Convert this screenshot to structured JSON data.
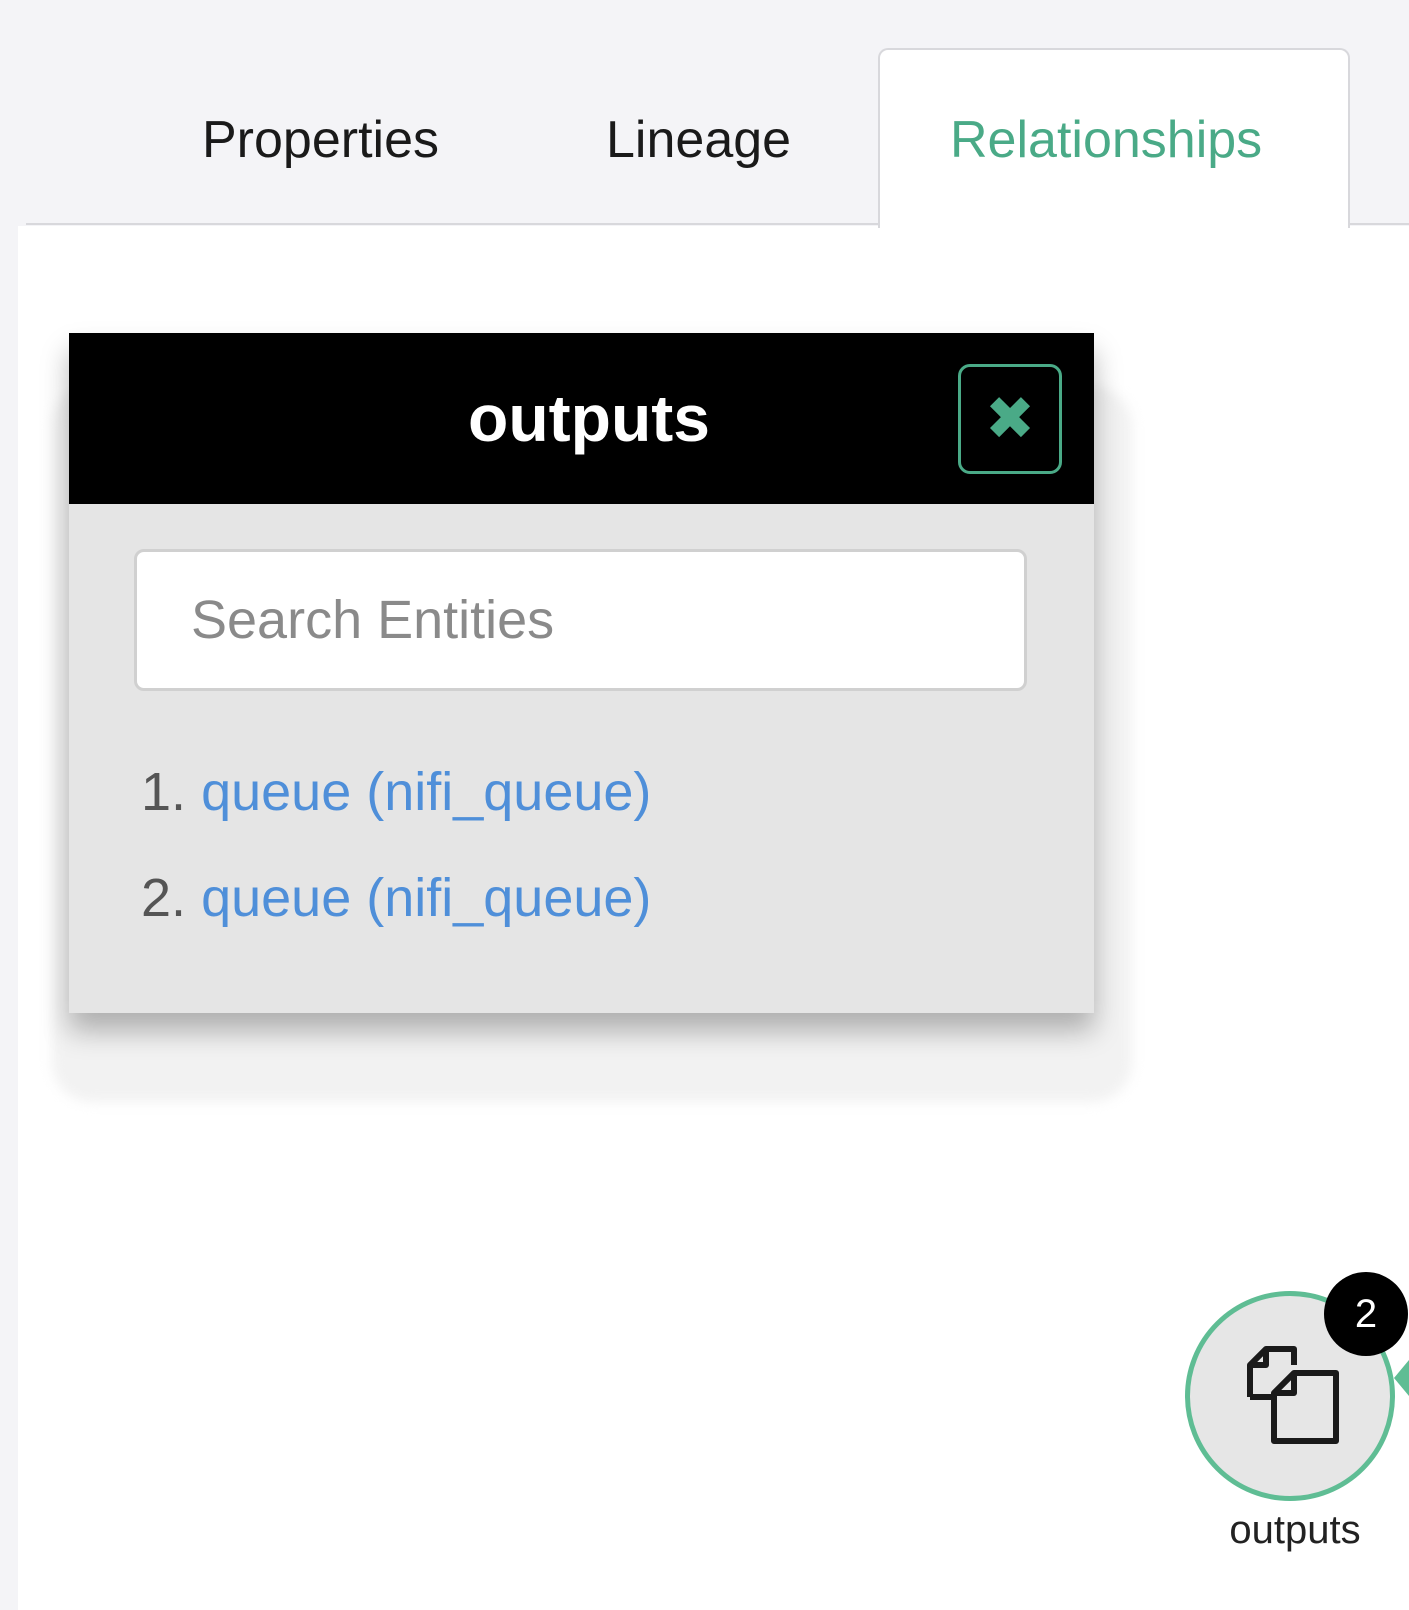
{
  "tabs": [
    {
      "label": "Properties",
      "active": false
    },
    {
      "label": "Lineage",
      "active": false
    },
    {
      "label": "Relationships",
      "active": true
    }
  ],
  "popup": {
    "title": "outputs",
    "close_icon": "close-icon",
    "search": {
      "placeholder": "Search Entities",
      "value": ""
    },
    "results": [
      {
        "number": "1.",
        "label": "queue (nifi_queue)"
      },
      {
        "number": "2.",
        "label": "queue (nifi_queue)"
      }
    ]
  },
  "node": {
    "label": "outputs",
    "badge_count": "2",
    "icon": "copy-documents-icon"
  },
  "colors": {
    "accent": "#4aaa87",
    "link": "#4f8fd9",
    "popup_header": "#000000",
    "popup_body": "#e5e5e5"
  }
}
